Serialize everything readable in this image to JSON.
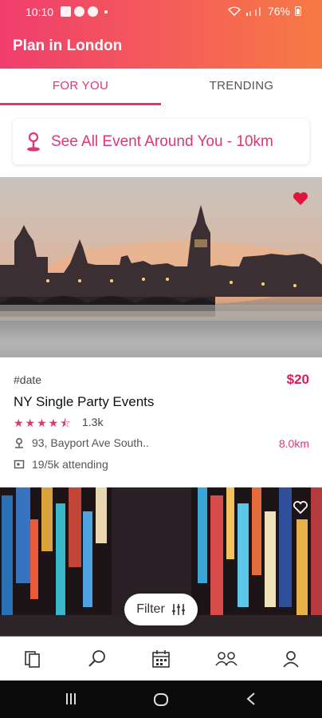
{
  "status_bar": {
    "time": "10:10",
    "battery": "76%"
  },
  "app": {
    "title": "Plan in London"
  },
  "tabs": [
    {
      "label": "FOR YOU"
    },
    {
      "label": "TRENDING"
    }
  ],
  "around": {
    "label": "See All Event Around You - 10km",
    "icon": "location-pin-icon"
  },
  "events": [
    {
      "date_tag": "#date",
      "price": "$20",
      "name": "NY Single Party Events",
      "rating": 4.5,
      "stars": "★★★★⯪",
      "rating_count": "1.3k",
      "address": "93, Bayport Ave South..",
      "distance": "8.0km",
      "attending": "19/5k attending",
      "favorited": true
    },
    {
      "favorited": false
    }
  ],
  "filter": {
    "label": "Filter"
  },
  "bottom_nav": [
    {
      "icon": "events-icon"
    },
    {
      "icon": "search-icon"
    },
    {
      "icon": "calendar-icon"
    },
    {
      "icon": "groups-icon"
    },
    {
      "icon": "profile-icon"
    }
  ],
  "colors": {
    "accent": "#e0347a",
    "price": "#d81b60",
    "header_start": "#ef3d6e",
    "header_end": "#f77a45"
  }
}
